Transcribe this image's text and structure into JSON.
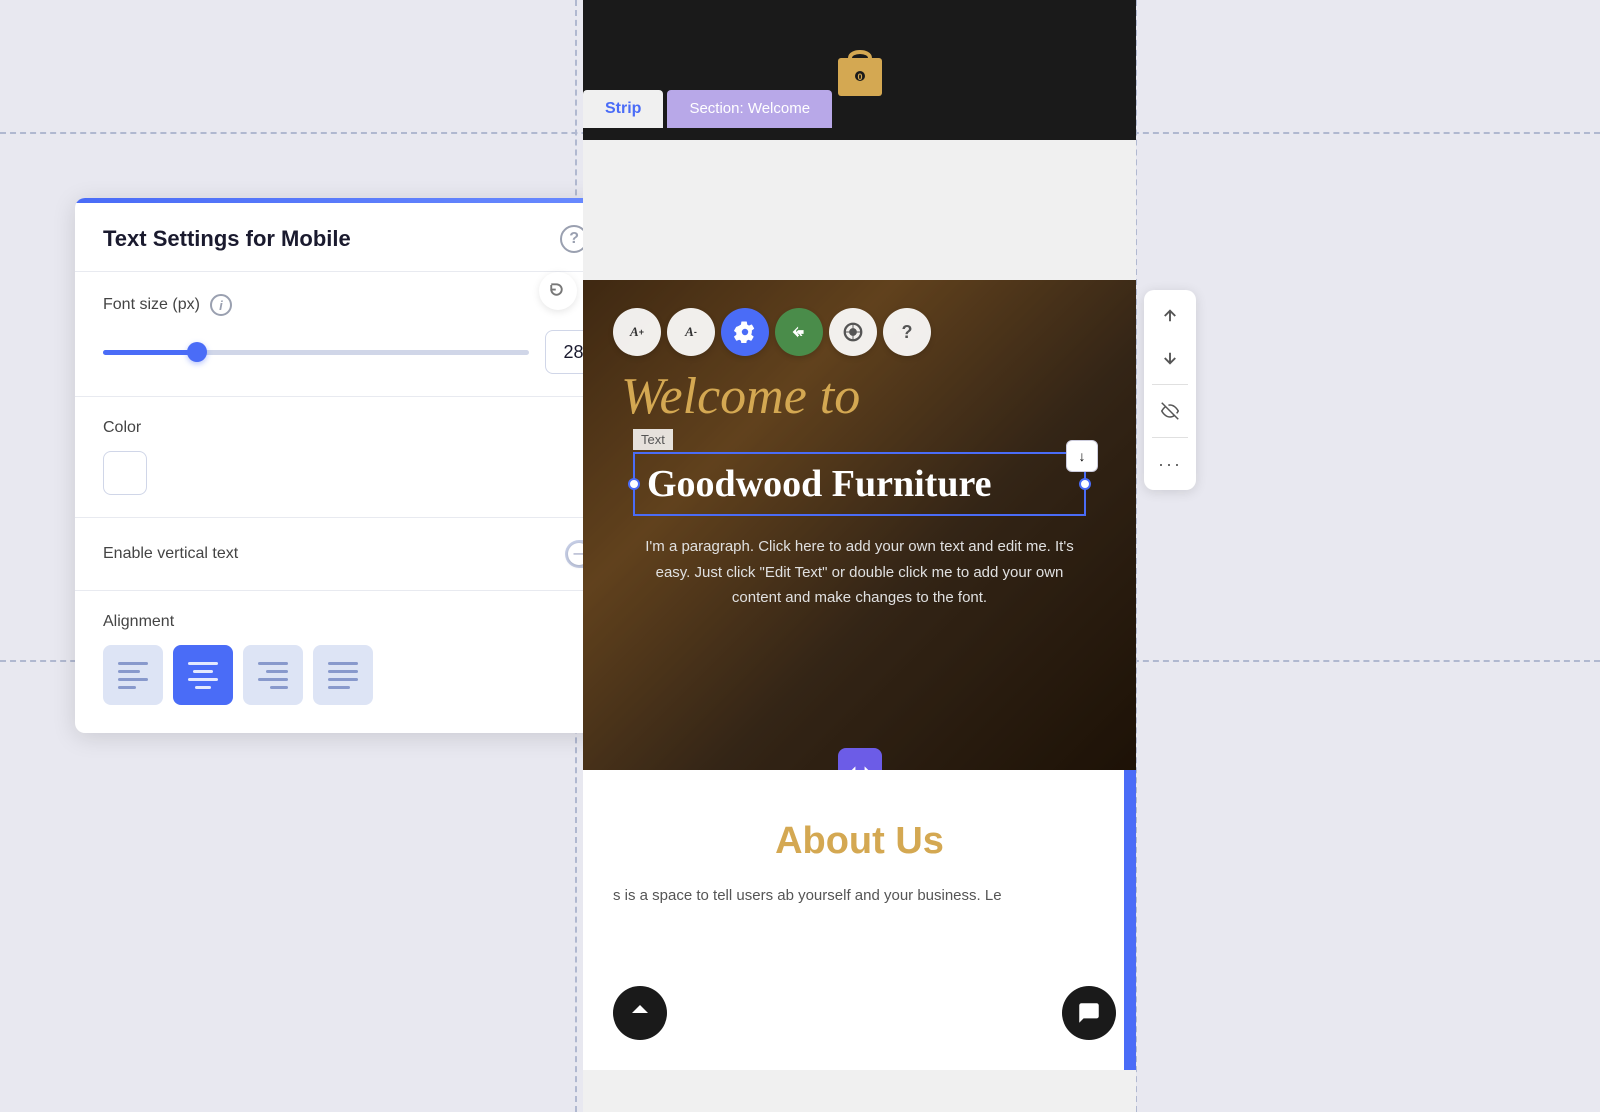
{
  "background": "#e8e8f0",
  "panel": {
    "title": "Text Settings for Mobile",
    "help_label": "?",
    "close_label": "×",
    "font_size_label": "Font size (px)",
    "font_size_value": "28",
    "font_size_number": 28,
    "slider_fill_pct": 22,
    "color_label": "Color",
    "vertical_text_label": "Enable vertical text",
    "toggle_active": false,
    "alignment_label": "Alignment",
    "alignment_buttons": [
      {
        "id": "left",
        "active": false
      },
      {
        "id": "center",
        "active": true
      },
      {
        "id": "right",
        "active": false
      },
      {
        "id": "justify",
        "active": false
      }
    ]
  },
  "preview": {
    "strip_tab": "Strip",
    "section_tab": "Section: Welcome",
    "welcome_text": "Welcome to",
    "text_label": "Text",
    "heading": "Goodwood Furniture",
    "paragraph": "I'm a paragraph. Click here to add your own text and edit me. It's easy. Just click \"Edit Text\" or double click me to add your own content and make changes to the font.",
    "about_title": "About Us",
    "about_text": "s is a space to tell users ab yourself and your business. Le"
  },
  "toolbar_icons": [
    {
      "id": "increase-font",
      "label": "A+",
      "active": false
    },
    {
      "id": "decrease-font",
      "label": "A-",
      "active": false
    },
    {
      "id": "settings",
      "label": "⚙",
      "active": true
    },
    {
      "id": "back",
      "label": "«",
      "active": true
    },
    {
      "id": "search",
      "label": "◎",
      "active": false
    },
    {
      "id": "help",
      "label": "?",
      "active": false
    }
  ]
}
